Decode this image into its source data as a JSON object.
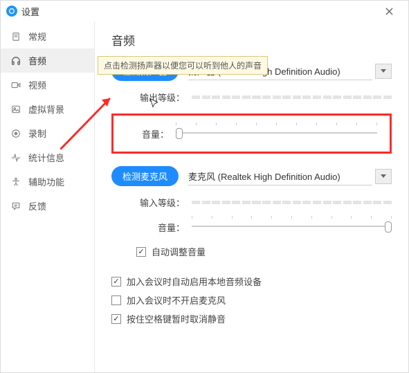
{
  "window": {
    "title": "设置"
  },
  "sidebar": {
    "items": [
      {
        "label": "常规"
      },
      {
        "label": "音频"
      },
      {
        "label": "视频"
      },
      {
        "label": "虚拟背景"
      },
      {
        "label": "录制"
      },
      {
        "label": "统计信息"
      },
      {
        "label": "辅助功能"
      },
      {
        "label": "反馈"
      }
    ]
  },
  "page": {
    "title": "音频"
  },
  "tooltip": {
    "text": "点击检测扬声器以便您可以听到他人的声音"
  },
  "speaker": {
    "test_label": "检测扬声器",
    "device": "扬声器 (Realtek High Definition Audio)",
    "output_label": "输出等级：",
    "volume_label": "音量："
  },
  "mic": {
    "test_label": "检测麦克风",
    "device": "麦克风 (Realtek High Definition Audio)",
    "input_label": "输入等级：",
    "volume_label": "音量：",
    "auto_adjust": "自动调整音量"
  },
  "options": {
    "o1": "加入会议时自动启用本地音频设备",
    "o2": "加入会议时不开启麦克风",
    "o3": "按住空格键暂时取消静音"
  }
}
